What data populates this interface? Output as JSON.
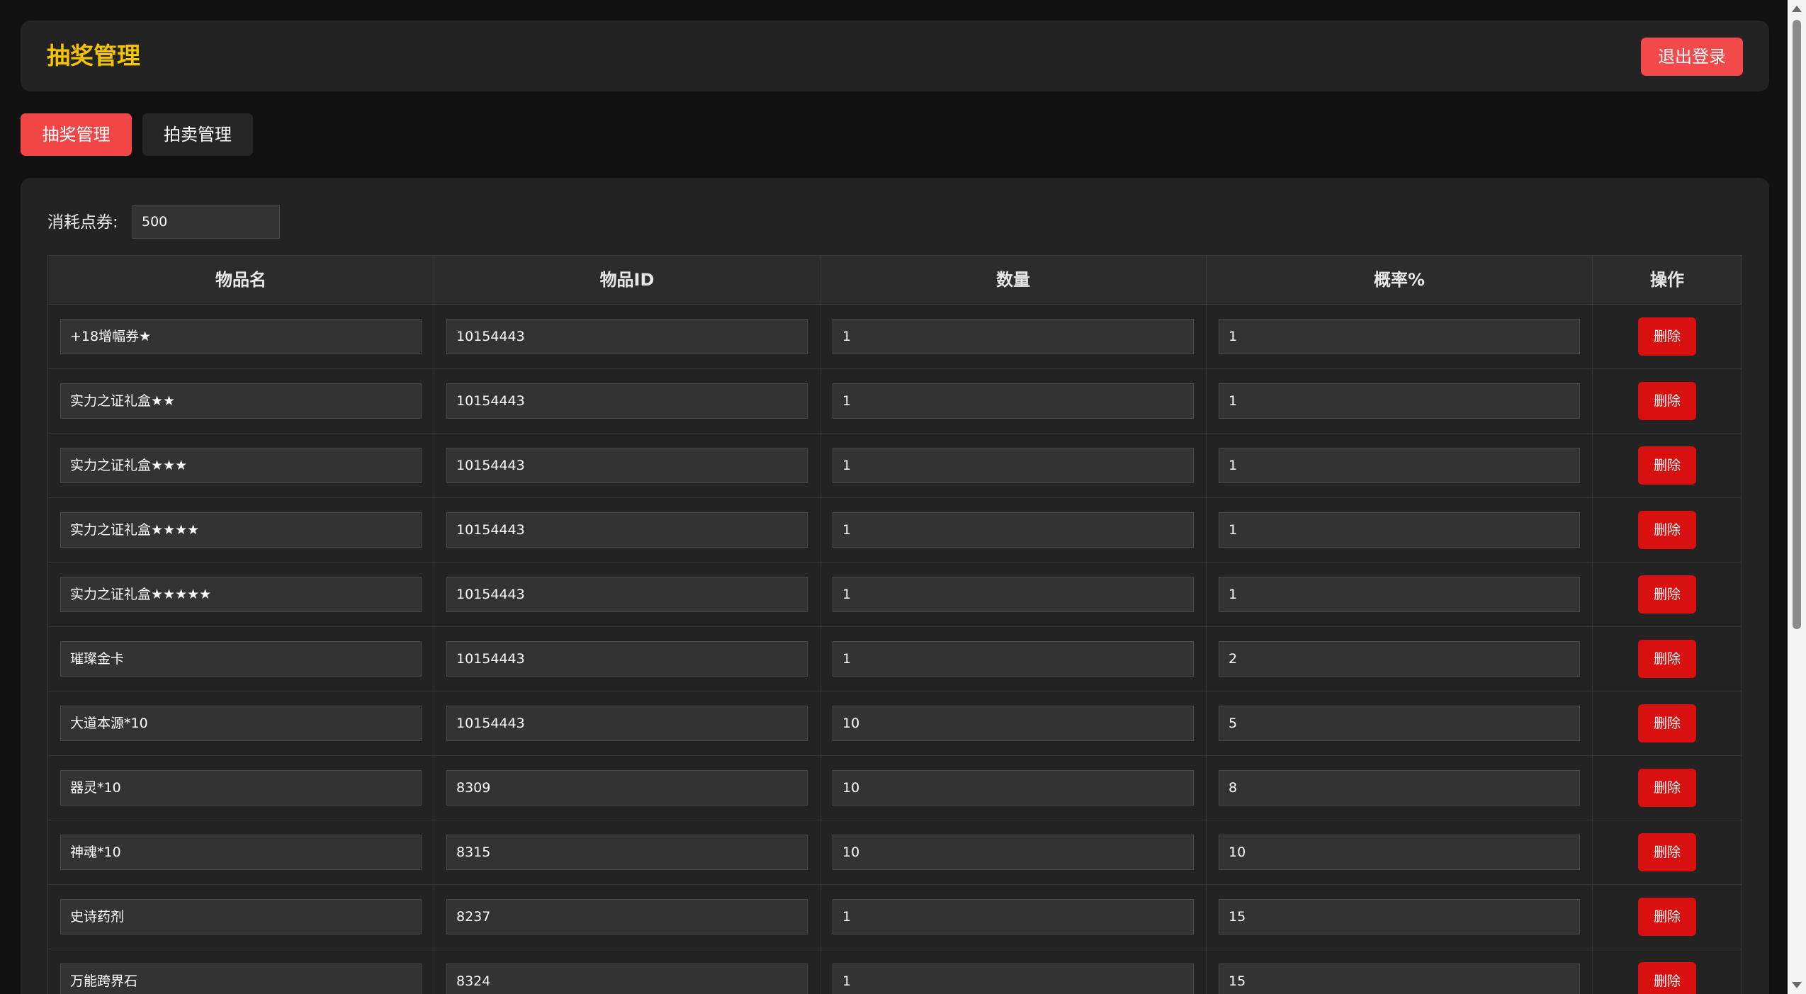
{
  "header": {
    "title": "抽奖管理",
    "logout_label": "退出登录"
  },
  "tabs": [
    {
      "label": "抽奖管理",
      "active": true
    },
    {
      "label": "拍卖管理",
      "active": false
    }
  ],
  "cost": {
    "label": "消耗点券:",
    "value": "500"
  },
  "table": {
    "headers": [
      "物品名",
      "物品ID",
      "数量",
      "概率%",
      "操作"
    ],
    "delete_label": "删除",
    "rows": [
      {
        "name": "+18增幅券★",
        "id": "10154443",
        "qty": "1",
        "rate": "1"
      },
      {
        "name": "实力之证礼盒★★",
        "id": "10154443",
        "qty": "1",
        "rate": "1"
      },
      {
        "name": "实力之证礼盒★★★",
        "id": "10154443",
        "qty": "1",
        "rate": "1"
      },
      {
        "name": "实力之证礼盒★★★★",
        "id": "10154443",
        "qty": "1",
        "rate": "1"
      },
      {
        "name": "实力之证礼盒★★★★★",
        "id": "10154443",
        "qty": "1",
        "rate": "1"
      },
      {
        "name": "璀璨金卡",
        "id": "10154443",
        "qty": "1",
        "rate": "2"
      },
      {
        "name": "大道本源*10",
        "id": "10154443",
        "qty": "10",
        "rate": "5"
      },
      {
        "name": "器灵*10",
        "id": "8309",
        "qty": "10",
        "rate": "8"
      },
      {
        "name": "神魂*10",
        "id": "8315",
        "qty": "10",
        "rate": "10"
      },
      {
        "name": "史诗药剂",
        "id": "8237",
        "qty": "1",
        "rate": "15"
      },
      {
        "name": "万能跨界石",
        "id": "8324",
        "qty": "1",
        "rate": "15"
      }
    ]
  },
  "colors": {
    "title_accent": "#f5c400",
    "primary_button": "#f24a4a",
    "delete_button": "#d91010",
    "background": "#111111",
    "panel": "#232323"
  }
}
